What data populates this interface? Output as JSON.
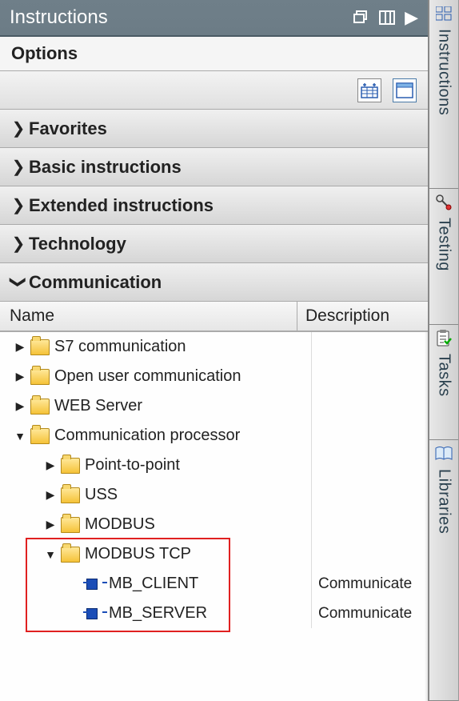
{
  "title": "Instructions",
  "options": "Options",
  "sections": {
    "favorites": "Favorites",
    "basic": "Basic instructions",
    "extended": "Extended instructions",
    "technology": "Technology",
    "communication": "Communication"
  },
  "columns": {
    "name": "Name",
    "desc": "Description"
  },
  "tree": {
    "s7": "S7 communication",
    "ouc": "Open user communication",
    "web": "WEB Server",
    "commproc": "Communication processor",
    "p2p": "Point-to-point",
    "uss": "USS",
    "modbus": "MODBUS",
    "modbustcp": "MODBUS TCP",
    "mbclient": {
      "name": "MB_CLIENT",
      "desc": "Communicate"
    },
    "mbserver": {
      "name": "MB_SERVER",
      "desc": "Communicate"
    }
  },
  "sidetabs": {
    "instructions": "Instructions",
    "testing": "Testing",
    "tasks": "Tasks",
    "libraries": "Libraries"
  }
}
